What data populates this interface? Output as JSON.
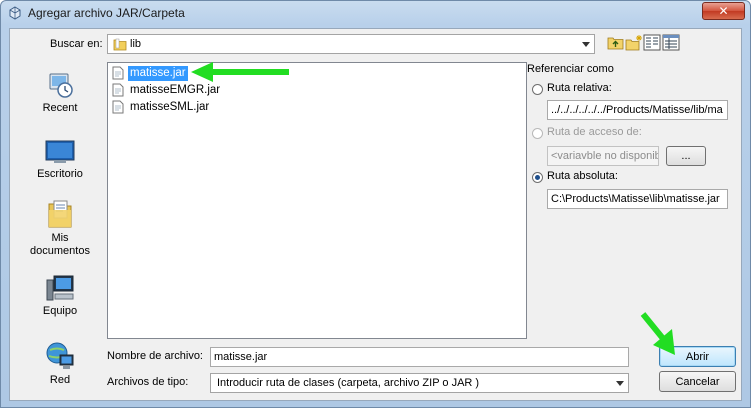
{
  "window": {
    "title": "Agregar archivo JAR/Carpeta",
    "close_label": "✕"
  },
  "lookin": {
    "label": "Buscar en:",
    "value": "lib"
  },
  "toolbar": {
    "icons": [
      "up-folder-icon",
      "new-folder-icon",
      "list-view-icon",
      "details-view-icon"
    ]
  },
  "places": [
    {
      "label": "Recent",
      "icon": "recent-icon"
    },
    {
      "label": "Escritorio",
      "icon": "desktop-icon"
    },
    {
      "label": "Mis documentos",
      "icon": "documents-icon"
    },
    {
      "label": "Equipo",
      "icon": "computer-icon"
    },
    {
      "label": "Red",
      "icon": "network-icon"
    }
  ],
  "files": [
    {
      "name": "matisse.jar",
      "selected": true
    },
    {
      "name": "matisseEMGR.jar",
      "selected": false
    },
    {
      "name": "matisseSML.jar",
      "selected": false
    }
  ],
  "reference": {
    "title": "Referenciar como",
    "relative": {
      "label": "Ruta relativa:",
      "value": "../../../../../../Products/Matisse/lib/ma",
      "checked": false
    },
    "access": {
      "label": "Ruta de acceso de:",
      "value": "<variavble no disponible>",
      "button": "...",
      "enabled": false
    },
    "absolute": {
      "label": "Ruta absoluta:",
      "value": "C:\\Products\\Matisse\\lib\\matisse.jar",
      "checked": true
    }
  },
  "filename": {
    "label": "Nombre de archivo:",
    "value": "matisse.jar"
  },
  "filetype": {
    "label": "Archivos de tipo:",
    "value": "Introducir ruta de clases (carpeta, archivo ZIP o JAR )"
  },
  "buttons": {
    "open": "Abrir",
    "cancel": "Cancelar"
  },
  "colors": {
    "selection": "#3399ff",
    "annotation_arrow": "#22dd22",
    "titlebar": "#b8d0ea"
  }
}
